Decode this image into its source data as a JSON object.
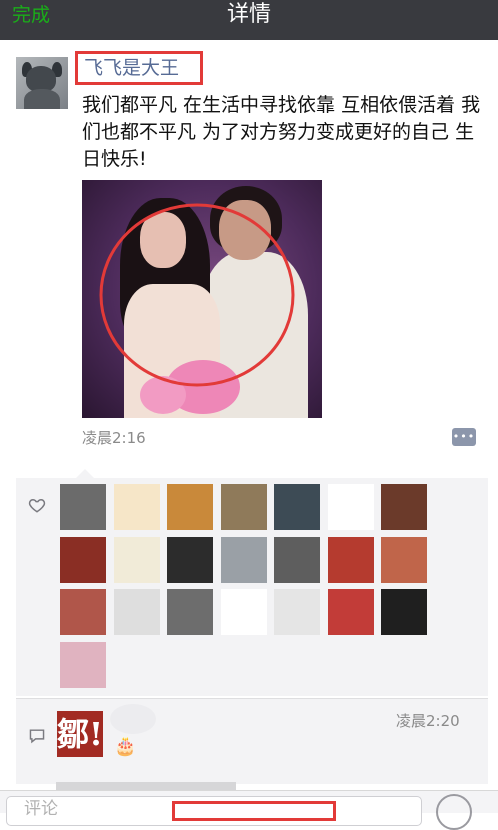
{
  "nav": {
    "back_label": "完成",
    "title": "详情"
  },
  "post": {
    "author": "飞飞是大王",
    "text": "我们都平凡 在生活中寻找依靠 互相依偎活着 我们也都不平凡 为了对方努力变成更好的自己 生日快乐!",
    "time": "凌晨2:16",
    "comment_button_icon": "comment-dots-icon"
  },
  "likes": {
    "icon": "heart-icon",
    "avatars": [
      "avatar",
      "avatar",
      "avatar",
      "avatar",
      "avatar",
      "avatar",
      "avatar",
      "avatar",
      "avatar",
      "avatar",
      "avatar",
      "avatar",
      "avatar",
      "avatar",
      "avatar",
      "avatar",
      "avatar",
      "avatar",
      "avatar",
      "avatar",
      "avatar",
      "avatar"
    ]
  },
  "comment": {
    "icon": "comment-icon",
    "avatar_text": "鄒!",
    "time": "凌晨2:20",
    "emoji": "🎂"
  },
  "input": {
    "placeholder": "评论",
    "emoji_icon": "smiley-icon"
  },
  "colors": {
    "nav_bg": "#393a3f",
    "accent": "#1aad19",
    "link": "#576b95",
    "highlight": "#e23a38"
  }
}
